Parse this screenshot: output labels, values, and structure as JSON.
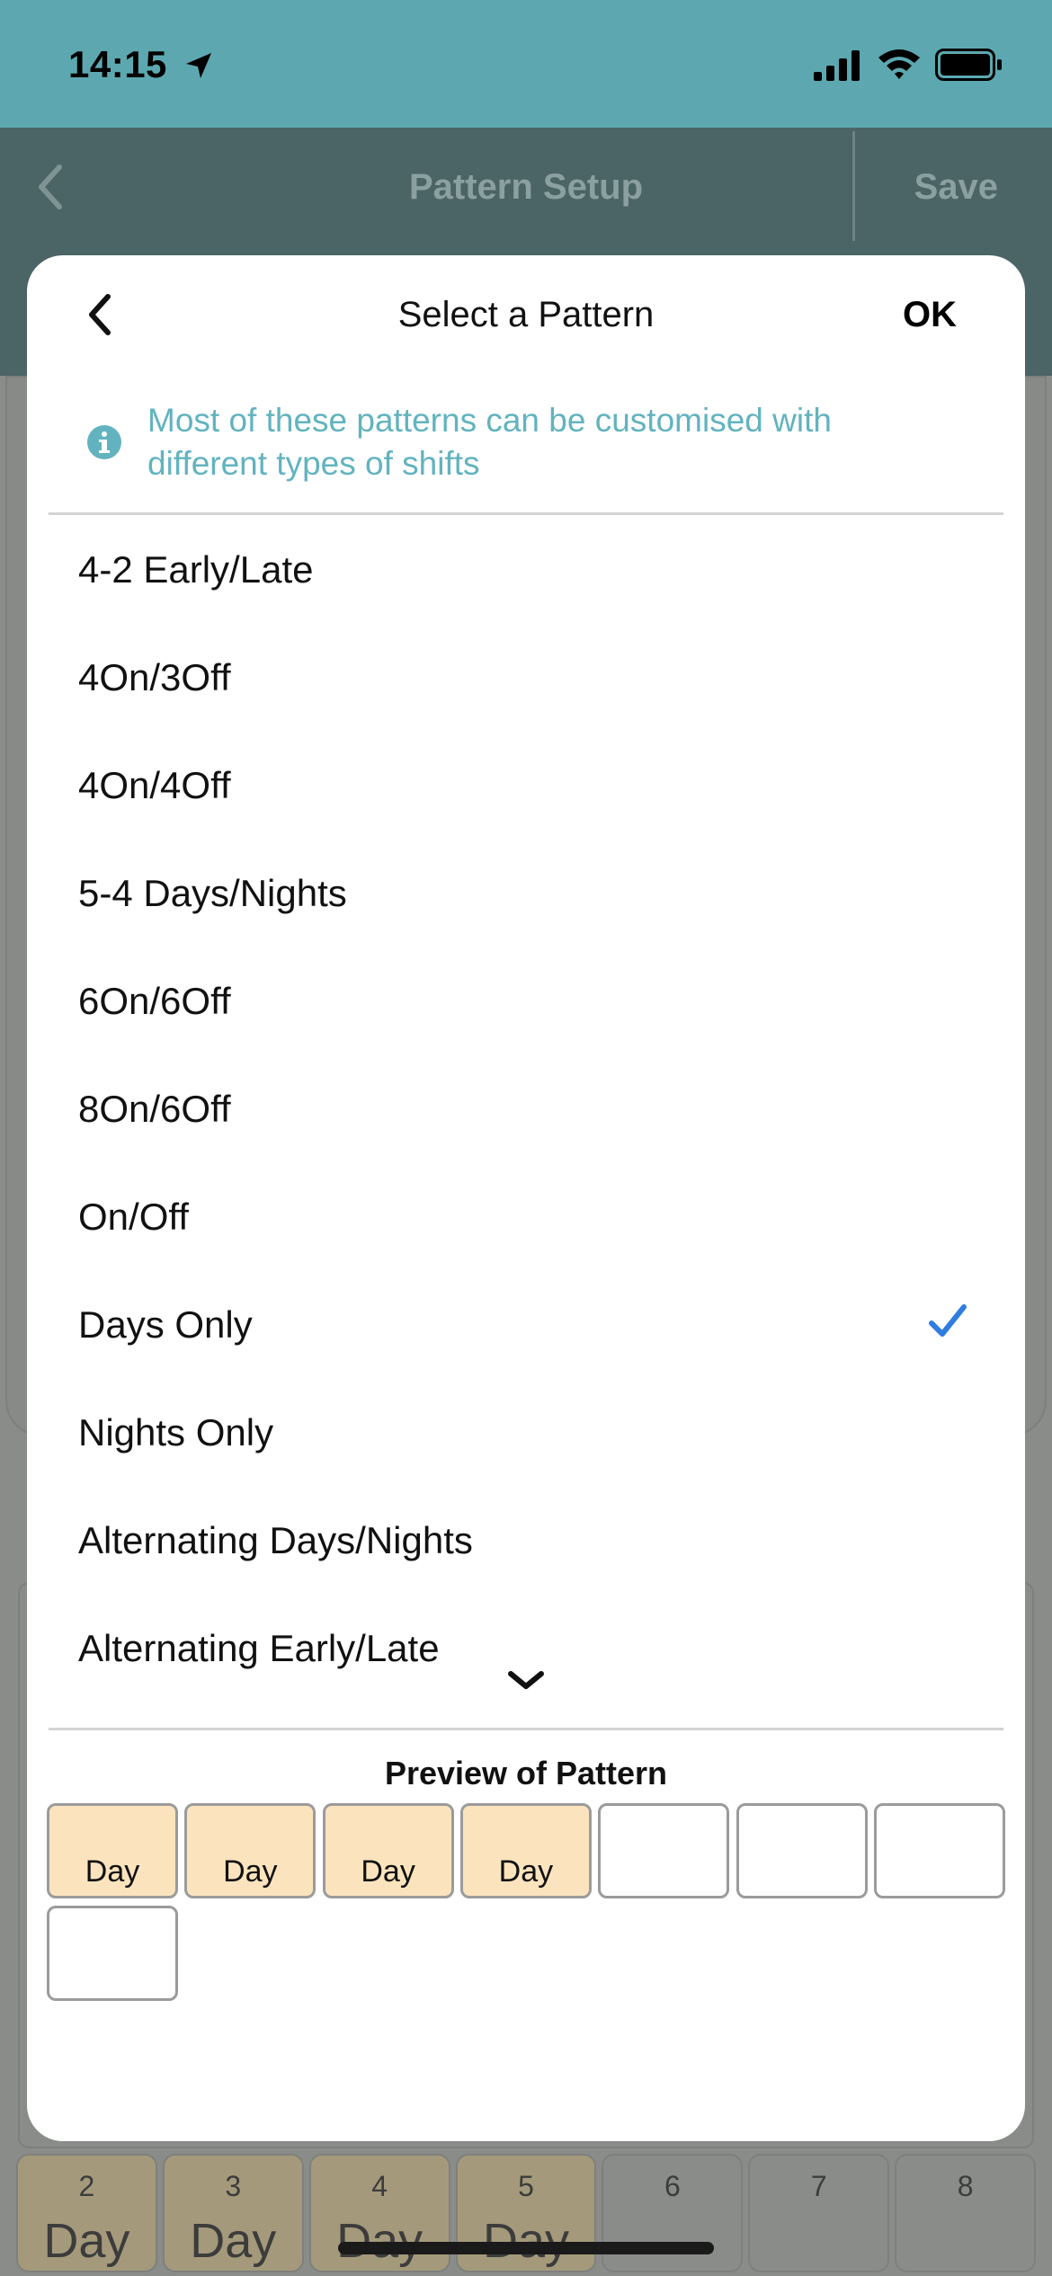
{
  "status_bar": {
    "time": "14:15"
  },
  "nav": {
    "title": "Pattern Setup",
    "save_label": "Save"
  },
  "background_row": [
    {
      "num": "2",
      "label": "Day"
    },
    {
      "num": "3",
      "label": "Day"
    },
    {
      "num": "4",
      "label": "Day"
    },
    {
      "num": "5",
      "label": "Day"
    },
    {
      "num": "6",
      "label": ""
    },
    {
      "num": "7",
      "label": ""
    },
    {
      "num": "8",
      "label": ""
    }
  ],
  "modal": {
    "title": "Select a Pattern",
    "ok_label": "OK",
    "info_text": "Most of these patterns can be customised with different types of shifts",
    "patterns": [
      {
        "label": "4-2 Early/Late",
        "selected": false
      },
      {
        "label": "4On/3Off",
        "selected": false
      },
      {
        "label": "4On/4Off",
        "selected": false
      },
      {
        "label": "5-4 Days/Nights",
        "selected": false
      },
      {
        "label": "6On/6Off",
        "selected": false
      },
      {
        "label": "8On/6Off",
        "selected": false
      },
      {
        "label": "On/Off",
        "selected": false
      },
      {
        "label": "Days Only",
        "selected": true
      },
      {
        "label": "Nights Only",
        "selected": false
      },
      {
        "label": "Alternating Days/Nights",
        "selected": false
      },
      {
        "label": "Alternating Early/Late",
        "selected": false
      }
    ],
    "preview_title": "Preview of Pattern",
    "preview_cells": [
      "Day",
      "Day",
      "Day",
      "Day",
      "",
      "",
      "",
      ""
    ]
  },
  "colors": {
    "accent": "#5da8b0",
    "info_text": "#62b3bf",
    "check": "#2f7de1",
    "day_cell": "#fbe4bd"
  },
  "icons": {
    "status_location": "location-arrow-icon",
    "status_signal": "cellular-signal-icon",
    "status_wifi": "wifi-icon",
    "status_battery": "battery-icon",
    "nav_back": "chevron-left-icon",
    "modal_back": "chevron-left-icon",
    "info": "info-icon",
    "check": "checkmark-icon",
    "more": "chevron-down-icon"
  }
}
